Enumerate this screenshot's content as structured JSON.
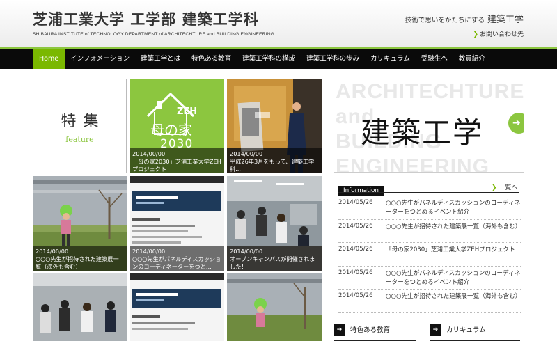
{
  "header": {
    "title": "芝浦工業大学 工学部 建築工学科",
    "subtitle": "SHIBAURA INSTITUTE of TECHNOLOGY  DEPARTMENT of ARCHITECHTURE and BUILDING ENGINEERING",
    "tagline_small": "技術で思いをかたちにする",
    "tagline_large": "建築工学",
    "contact": "お問い合わせ先"
  },
  "nav": {
    "items": [
      "Home",
      "インフォメーション",
      "建築工学とは",
      "特色ある教育",
      "建築工学科の構成",
      "建築工学科の歩み",
      "カリキュラム",
      "受験生へ",
      "教員紹介"
    ],
    "active": "Home"
  },
  "feature": {
    "title": "特集",
    "subtitle": "feature"
  },
  "tiles": [
    {
      "date": "2014/00/00",
      "text": "「母の家2030」芝浦工業大学ZEHプロジェクト"
    },
    {
      "date": "2014/00/00",
      "text": "平成26年3月をもって、建築工学科..."
    },
    {
      "date": "2014/00/00",
      "text": "○○○先生が招待された建築展一覧（海外も含む）"
    },
    {
      "date": "2014/00/00",
      "text": "○○○先生がパネルディスカッションのコーディネーターをつと..."
    },
    {
      "date": "2014/00/00",
      "text": "オープンキャンパスが開催されました！"
    }
  ],
  "zeh": {
    "label": "ZEH",
    "name": "母の家",
    "year": "2030"
  },
  "banner": {
    "bg_text": [
      "ARCHITECHTURE",
      "and",
      "BUILDING",
      "ENGINEERING"
    ],
    "title": "建築工学"
  },
  "info": {
    "label": "Information",
    "more": "一覧へ",
    "items": [
      {
        "date": "2014/05/26",
        "text": "○○○先生がパネルディスカッションのコーディネーターをつとめるイベント紹介"
      },
      {
        "date": "2014/05/26",
        "text": "○○○先生が招待された建築展一覧（海外も含む）"
      },
      {
        "date": "2014/05/26",
        "text": "「母の家2030」芝浦工業大学ZEHプロジェクト"
      },
      {
        "date": "2014/05/26",
        "text": "○○○先生がパネルディスカッションのコーディネーターをつとめるイベント紹介"
      },
      {
        "date": "2014/05/26",
        "text": "○○○先生が招待された建築展一覧（海外も含む）"
      }
    ]
  },
  "bottom_buttons": [
    "特色ある教育",
    "カリキュラム"
  ],
  "colors": {
    "accent": "#8cc63f",
    "nav_bg": "#0a0a0a",
    "text": "#333333"
  }
}
